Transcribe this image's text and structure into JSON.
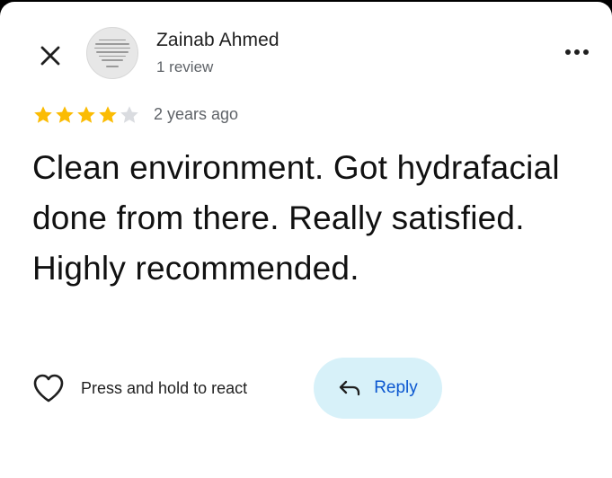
{
  "header": {
    "close_icon": "close-icon",
    "reviewer_name": "Zainab Ahmed",
    "review_count": "1 review",
    "more_icon": "more-options-icon"
  },
  "rating": {
    "stars": 4,
    "max_stars": 5,
    "time_ago": "2 years ago",
    "star_filled_color": "#fbbc04",
    "star_empty_color": "#dadce0"
  },
  "review": {
    "text": "Clean environment. Got hydrafacial done from there. Really satisfied. Highly recommended."
  },
  "actions": {
    "react_label": "Press and hold to react",
    "react_icon": "heart-outline-icon",
    "reply_label": "Reply",
    "reply_icon": "reply-arrow-icon",
    "reply_bg_color": "#d7f1f9",
    "reply_text_color": "#0b57d0"
  }
}
